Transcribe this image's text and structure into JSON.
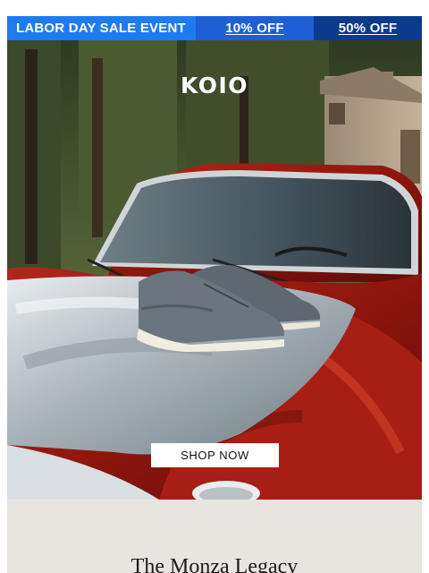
{
  "promo_bar": {
    "title": "LABOR DAY SALE EVENT",
    "link_10": "10% OFF",
    "link_50": "50% OFF",
    "colors": {
      "title_bg": "#1f7bf0",
      "link_10_bg": "#1f5fd6",
      "link_50_bg": "#0c3a8c"
    }
  },
  "hero": {
    "brand": "KOIO",
    "cta": "SHOP NOW",
    "image_subject": "grey suede sneakers on the bonnet of a red vintage car"
  },
  "section": {
    "title": "The Monza Legacy",
    "background": "#e8e5e0"
  }
}
